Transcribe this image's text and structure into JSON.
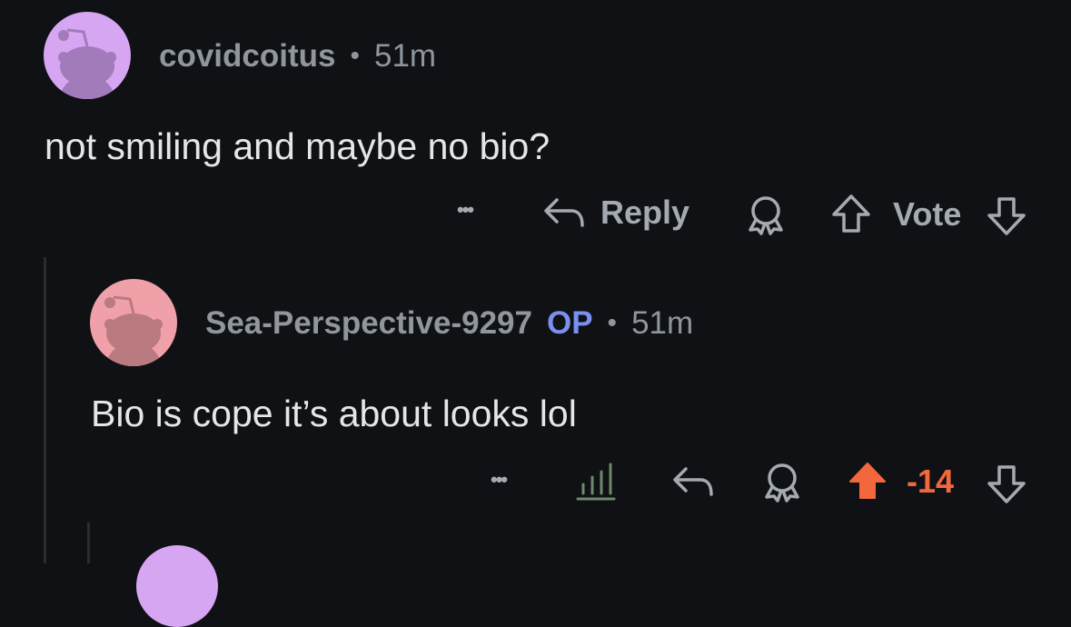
{
  "comments": [
    {
      "username": "covidcoitus",
      "separator": "•",
      "age": "51m",
      "text": "not smiling and maybe no bio?",
      "actions": {
        "more_label": "•••",
        "reply_label": "Reply",
        "vote_label": "Vote"
      },
      "avatar_color": "#d6a6f2"
    },
    {
      "username": "Sea-Perspective-9297",
      "op_badge": "OP",
      "separator": "•",
      "age": "51m",
      "text": "Bio is cope it’s about looks lol",
      "actions": {
        "more_label": "•••",
        "score": "-14"
      },
      "avatar_color": "#f0a0a8",
      "upvoted": true
    }
  ],
  "colors": {
    "background": "#101114",
    "upvote_active": "#f2683c",
    "op_badge": "#7a8ff0"
  }
}
